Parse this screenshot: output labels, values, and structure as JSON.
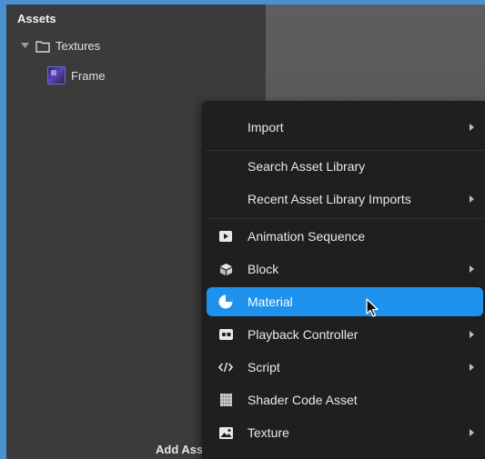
{
  "assets_panel": {
    "title": "Assets",
    "tree": {
      "folder_label": "Textures",
      "child_label": "Frame"
    },
    "footer": {
      "add_asset_label": "Add Asset",
      "add_asset_icon": "plus-icon"
    }
  },
  "context_menu": {
    "items": [
      {
        "label": "Import",
        "icon": "",
        "submenu": true
      },
      {
        "label": "Search Asset Library",
        "icon": "",
        "submenu": false
      },
      {
        "label": "Recent Asset Library Imports",
        "icon": "",
        "submenu": true
      },
      {
        "label": "Animation Sequence",
        "icon": "play-square-icon",
        "submenu": false
      },
      {
        "label": "Block",
        "icon": "cube-icon",
        "submenu": true
      },
      {
        "label": "Material",
        "icon": "material-sphere-icon",
        "submenu": false,
        "selected": true
      },
      {
        "label": "Playback Controller",
        "icon": "playback-controller-icon",
        "submenu": true
      },
      {
        "label": "Script",
        "icon": "code-icon",
        "submenu": true
      },
      {
        "label": "Shader Code Asset",
        "icon": "shader-grid-icon",
        "submenu": false
      },
      {
        "label": "Texture",
        "icon": "image-icon",
        "submenu": true
      }
    ]
  },
  "colors": {
    "selection_accent": "#1d91ec",
    "menu_background": "#1f1f1f",
    "panel_background": "#3b3b3b",
    "outer_border": "#4a8fcf"
  }
}
